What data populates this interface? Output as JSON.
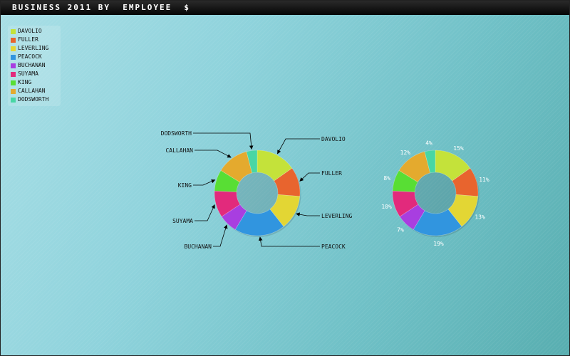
{
  "window": {
    "title": "BUSINESS 2011 BY  EMPLOYEE  $"
  },
  "chart_data": {
    "type": "pie",
    "variant": "donut",
    "title": "BUSINESS 2011 BY  EMPLOYEE  $",
    "legend_position": "top-left",
    "categories": [
      "DAVOLIO",
      "FULLER",
      "LEVERLING",
      "PEACOCK",
      "BUCHANAN",
      "SUYAMA",
      "KING",
      "CALLAHAN",
      "DODSWORTH"
    ],
    "values": [
      15,
      11,
      13,
      19,
      7,
      10,
      8,
      12,
      4
    ],
    "percent_labels": [
      "15%",
      "11%",
      "13%",
      "19%",
      "7%",
      "10%",
      "8%",
      "12%",
      "4%"
    ],
    "colors": [
      "#c4e23a",
      "#e8642e",
      "#e3d634",
      "#3195df",
      "#a83ee0",
      "#e22a7c",
      "#58de34",
      "#e4aa2e",
      "#48d6a4"
    ],
    "charts": [
      {
        "id": "labeled-donut",
        "label_mode": "category-callouts"
      },
      {
        "id": "percent-donut",
        "label_mode": "percent"
      }
    ]
  }
}
